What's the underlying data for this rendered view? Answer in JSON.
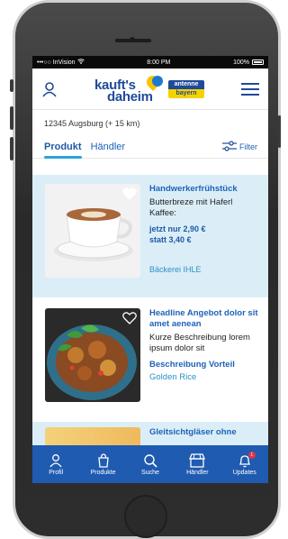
{
  "status_bar": {
    "carrier": "•••○○ InVision",
    "time": "8:00 PM",
    "battery": "100%"
  },
  "header": {
    "logo_line1": "kauft's",
    "logo_line2": "daheim",
    "partner_top": "antenne",
    "partner_bottom": "bayern",
    "brand_color": "#1e4a9a",
    "accent_yellow": "#f5c400"
  },
  "location": {
    "text": "12345 Augsburg (+ 15 km)"
  },
  "tabs": [
    {
      "label": "Produkt",
      "active": true
    },
    {
      "label": "Händler",
      "active": false
    }
  ],
  "filter": {
    "label": "Filter"
  },
  "products": [
    {
      "title": "Handwerkerfrühstück",
      "description": "Butterbreze mit Haferl Kaffee:",
      "price_now": "jetzt nur 2,90 €",
      "price_before": "statt 3,40 €",
      "vendor": "Bäckerei IHLE"
    },
    {
      "title": "Headline Angebot dolor sit amet aenean",
      "description": "Kurze Beschreibung lorem ipsum dolor sit",
      "benefit": "Beschreibung Vorteil",
      "vendor": "Golden Rice"
    },
    {
      "title": "Gleitsichtgläser ohne"
    }
  ],
  "bottom_nav": [
    {
      "label": "Profil",
      "icon": "person-icon"
    },
    {
      "label": "Produkte",
      "icon": "bag-icon"
    },
    {
      "label": "Suche",
      "icon": "search-icon"
    },
    {
      "label": "Händler",
      "icon": "shop-icon"
    },
    {
      "label": "Updates",
      "icon": "bell-icon",
      "badge": "1"
    }
  ]
}
